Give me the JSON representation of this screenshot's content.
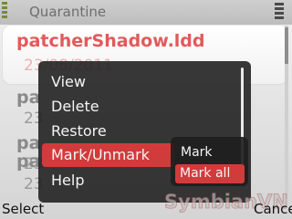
{
  "app": {
    "title": "Quarantine"
  },
  "list": {
    "items": [
      {
        "name": "patcherShadow.ldd",
        "date": "23/08/2011"
      },
      {
        "name": "pa",
        "date": "23"
      },
      {
        "name": "pa",
        "date": "23"
      },
      {
        "name": "pa",
        "date": "23"
      }
    ]
  },
  "menu": {
    "items": [
      "View",
      "Delete",
      "Restore",
      "Mark/Unmark",
      "Help"
    ],
    "highlighted": "Mark/Unmark"
  },
  "submenu": {
    "items": [
      "Mark",
      "Mark all"
    ],
    "highlighted": "Mark all"
  },
  "softkeys": {
    "left": "Select",
    "right": "Cancel"
  },
  "watermark": {
    "text": "SymbianVN"
  },
  "colors": {
    "accent": "#d23b3b",
    "selected_text": "#e25a5a",
    "menu_bg": "#222222"
  }
}
